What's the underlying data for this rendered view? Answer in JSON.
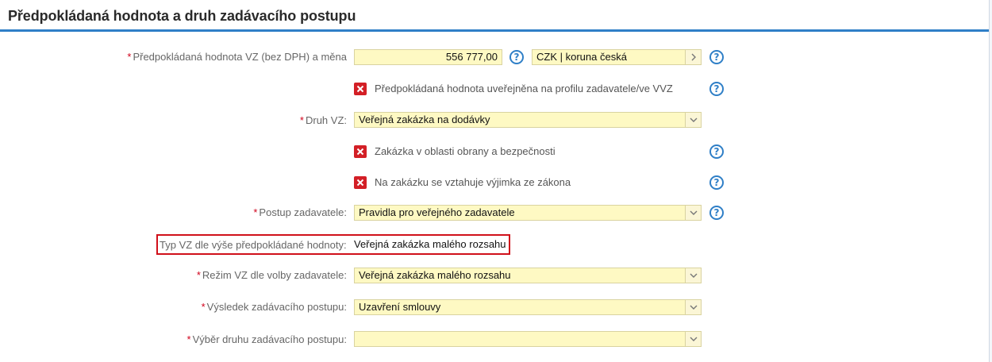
{
  "header": {
    "title": "Předpokládaná hodnota a druh zadávacího postupu"
  },
  "colors": {
    "accent": "#2f7fc7",
    "required": "#d0021b",
    "field_bg": "#fef9c3",
    "checkbox_off": "#d31f26",
    "highlight": "#d0101a"
  },
  "required_marker": "*",
  "rows": {
    "value": {
      "label": "Předpokládaná hodnota VZ (bez DPH) a měna",
      "amount": "556 777,00",
      "currency": "CZK | koruna česká"
    },
    "published": {
      "label": "Předpokládaná hodnota uveřejněna na profilu zadavatele/ve VVZ",
      "checked": false
    },
    "druh": {
      "label": "Druh VZ:",
      "value": "Veřejná zakázka na dodávky"
    },
    "obrana": {
      "label": "Zakázka v oblasti obrany a bezpečnosti",
      "checked": false
    },
    "vyjimka": {
      "label": "Na zakázku se vztahuje výjimka ze zákona",
      "checked": false
    },
    "postup": {
      "label": "Postup zadavatele:",
      "value": "Pravidla pro veřejného zadavatele"
    },
    "typ": {
      "label": "Typ VZ dle výše předpokládané hodnoty:",
      "value": "Veřejná zakázka malého rozsahu"
    },
    "rezim": {
      "label": "Režim VZ dle volby zadavatele:",
      "value": "Veřejná zakázka malého rozsahu"
    },
    "vysledek": {
      "label": "Výsledek zadávacího postupu:",
      "value": "Uzavření smlouvy"
    },
    "vyber": {
      "label": "Výběr druhu zadávacího postupu:",
      "value": ""
    }
  },
  "icons": {
    "help": "question-circle-icon",
    "unchecked": "x-box-icon",
    "dropdown": "chevron-down-icon",
    "picker": "chevron-right-icon"
  },
  "help_glyph": "?"
}
